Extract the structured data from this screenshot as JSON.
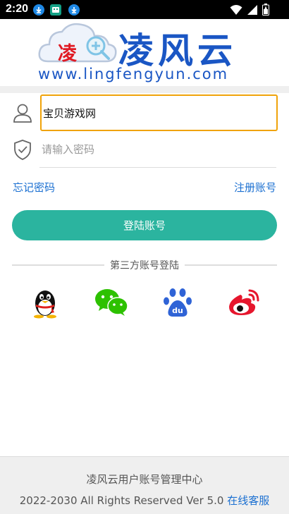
{
  "status_bar": {
    "time": "2:20",
    "notifications": [
      "download-icon",
      "app-icon",
      "download-icon"
    ],
    "system_icons": [
      "wifi-icon",
      "signal-icon",
      "battery-icon"
    ]
  },
  "logo": {
    "badge_text": "凌",
    "title": "凌风云",
    "url": "www.lingfengyun.com",
    "brand_color": "#1a56c4",
    "badge_color": "#e01b24"
  },
  "form": {
    "username_value": "宝贝游戏网",
    "password_placeholder": "请输入密码",
    "forgot_label": "忘记密码",
    "register_label": "注册账号",
    "login_label": "登陆账号",
    "accent_color": "#2bb49f",
    "focus_color": "#f0a30a"
  },
  "third_party": {
    "title": "第三方账号登陆",
    "providers": [
      "qq-icon",
      "wechat-icon",
      "baidu-icon",
      "weibo-icon"
    ]
  },
  "footer": {
    "title": "凌风云用户账号管理中心",
    "copyright": "2022-2030 All Rights Reserved Ver 5.0",
    "service_link": "在线客服",
    "link_color": "#1a6fd1"
  }
}
